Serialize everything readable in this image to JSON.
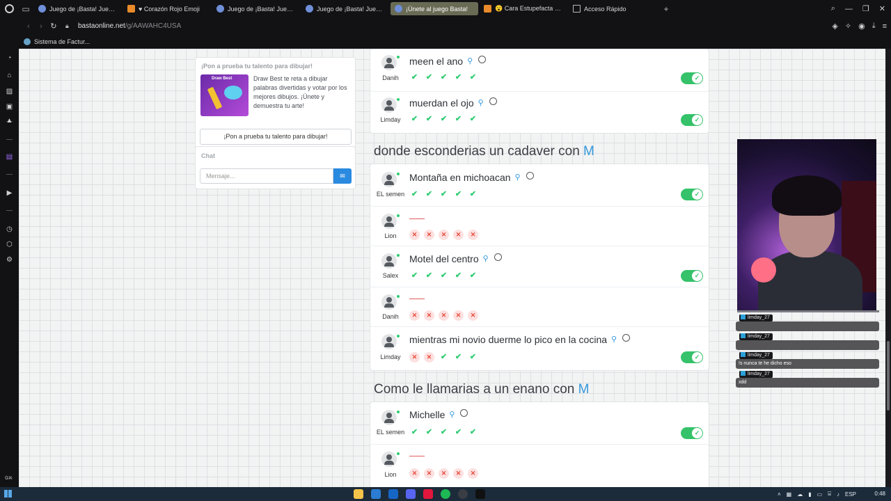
{
  "browser": {
    "tabs": [
      {
        "title": "Juego de ¡Basta! Juega S",
        "active": false
      },
      {
        "title": "♥ Corazón Rojo Emoji",
        "active": false
      },
      {
        "title": "Juego de ¡Basta! Juega S",
        "active": false
      },
      {
        "title": "Juego de ¡Basta! Juega S",
        "active": false
      },
      {
        "title": "¡Únete al juego Basta!",
        "active": true
      },
      {
        "title": "😮 Cara Estupefacta Emo",
        "active": false
      },
      {
        "title": "Acceso Rápido",
        "active": false
      }
    ],
    "url_host": "bastaonline.net",
    "url_path": "/g/AAWAHC4USA",
    "bookmark": "Sistema de Factur..."
  },
  "promo": {
    "title": "¡Pon a prueba tu talento para dibujar!",
    "image_title": "Draw Best",
    "description": "Draw Best te reta a dibujar palabras divertidas y votar por los mejores dibujos. ¡Únete y demuestra tu arte!",
    "button": "¡Pon a prueba tu talento para dibujar!"
  },
  "chat": {
    "title": "Chat",
    "placeholder": "Mensaje..."
  },
  "categories": [
    {
      "title": "",
      "letter": "",
      "rows": [
        {
          "user": "Danih",
          "answer": "meen el ano",
          "marks": [
            "ok",
            "ok",
            "ok",
            "ok",
            "ok"
          ],
          "approved": true
        },
        {
          "user": "Limday",
          "answer": "muerdan el ojo",
          "marks": [
            "ok",
            "ok",
            "ok",
            "ok",
            "ok"
          ],
          "approved": true
        }
      ]
    },
    {
      "title": "donde esconderias un cadaver con ",
      "letter": "M",
      "rows": [
        {
          "user": "EL semen",
          "answer": "Montaña en michoacan",
          "marks": [
            "ok",
            "ok",
            "ok",
            "ok",
            "ok"
          ],
          "approved": true
        },
        {
          "user": "Lion",
          "answer": "",
          "marks": [
            "bad",
            "bad",
            "bad",
            "bad",
            "bad"
          ],
          "approved": false
        },
        {
          "user": "Salex",
          "answer": "Motel del centro",
          "marks": [
            "ok",
            "ok",
            "ok",
            "ok",
            "ok"
          ],
          "approved": true
        },
        {
          "user": "Danih",
          "answer": "",
          "marks": [
            "bad",
            "bad",
            "bad",
            "bad",
            "bad"
          ],
          "approved": false
        },
        {
          "user": "Limday",
          "answer": "mientras mi novio duerme lo pico en la cocina",
          "marks": [
            "bad",
            "bad",
            "ok",
            "ok",
            "ok"
          ],
          "approved": true
        }
      ]
    },
    {
      "title": "Como le llamarias a un enano con ",
      "letter": "M",
      "rows": [
        {
          "user": "EL semen",
          "answer": "Michelle",
          "marks": [
            "ok",
            "ok",
            "ok",
            "ok",
            "ok"
          ],
          "approved": true
        },
        {
          "user": "Lion",
          "answer": "",
          "marks": [
            "bad",
            "bad",
            "bad",
            "bad",
            "bad"
          ],
          "approved": false
        }
      ]
    }
  ],
  "stream_chat": [
    {
      "user": "limday_27",
      "text": ""
    },
    {
      "user": "limday_27",
      "text": ""
    },
    {
      "user": "limday_27",
      "text": "!s nunca te he dicho eso"
    },
    {
      "user": "limday_27",
      "text": "xdd"
    }
  ],
  "taskbar": {
    "lang": "ESP",
    "time": "0:48"
  },
  "colors": {
    "accent": "#3498db",
    "ok": "#2ecc71",
    "bad": "#e74c3c",
    "active_tab": "#6a6b55"
  }
}
